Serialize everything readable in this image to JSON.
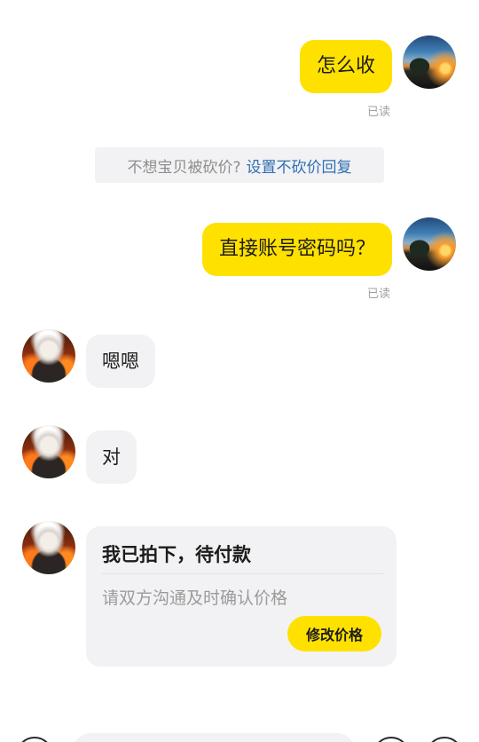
{
  "messages": {
    "m1": {
      "text": "怎么收",
      "status": "已读"
    },
    "notice": {
      "text": "不想宝贝被砍价?",
      "link": "设置不砍价回复"
    },
    "m2": {
      "text": "直接账号密码吗？",
      "status": "已读"
    },
    "m3": {
      "text": "嗯嗯"
    },
    "m4": {
      "text": "对"
    },
    "order_card": {
      "title": "我已拍下，待付款",
      "description": "请双方沟通及时确认价格",
      "button": "修改价格"
    }
  },
  "colors": {
    "my_bubble": "#ffe100",
    "their_bubble": "#f2f2f4",
    "link": "#2f6fb2"
  }
}
